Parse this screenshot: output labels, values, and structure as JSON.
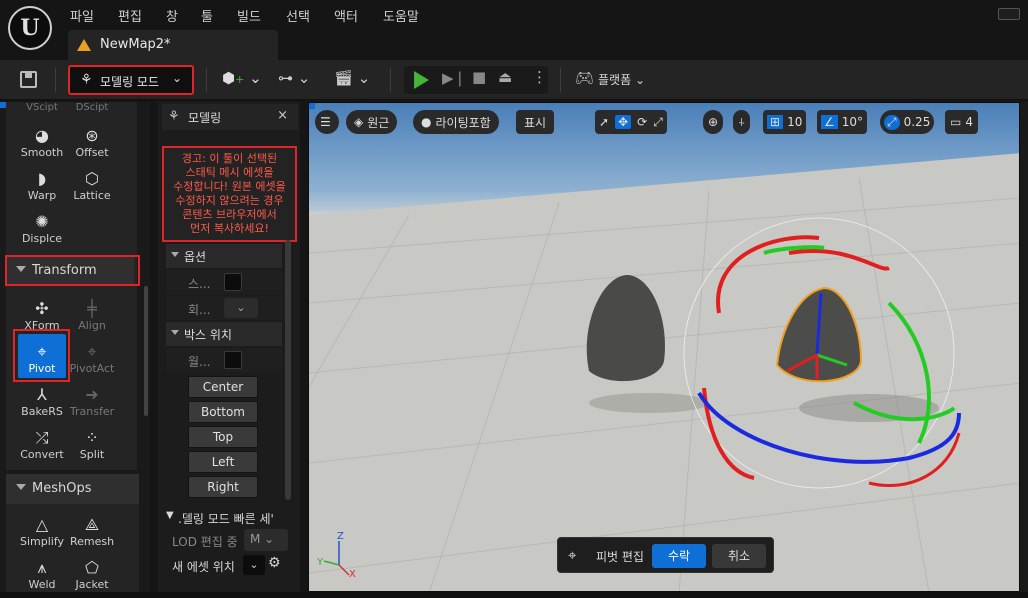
{
  "menu": {
    "logo": "U",
    "items": [
      "파일",
      "편집",
      "창",
      "툴",
      "빌드",
      "선택",
      "액터",
      "도움말"
    ]
  },
  "tab": {
    "label": "NewMap2*"
  },
  "toolbar": {
    "mode_label": "모델링 모드",
    "platform_label": "플랫폼"
  },
  "palette": {
    "top_labels": {
      "vscript": "VScipt",
      "dscript": "DScipt"
    },
    "tools_deform": [
      {
        "label": "Smooth",
        "icon": "smooth-icon"
      },
      {
        "label": "Offset",
        "icon": "offset-icon"
      },
      {
        "label": "Warp",
        "icon": "warp-icon"
      },
      {
        "label": "Lattice",
        "icon": "lattice-icon"
      },
      {
        "label": "Displce",
        "icon": "displace-icon"
      }
    ],
    "transform_section": "Transform",
    "tools_transform": [
      {
        "label": "XForm",
        "icon": "xform-icon"
      },
      {
        "label": "Align",
        "icon": "align-icon"
      },
      {
        "label": "Pivot",
        "icon": "pivot-icon"
      },
      {
        "label": "PivotAct",
        "icon": "pivot-actor-icon"
      },
      {
        "label": "BakeRS",
        "icon": "bake-rs-icon"
      },
      {
        "label": "Transfer",
        "icon": "transfer-icon"
      },
      {
        "label": "Convert",
        "icon": "convert-icon"
      },
      {
        "label": "Split",
        "icon": "split-icon"
      }
    ],
    "meshops_section": "MeshOps",
    "tools_meshops": [
      {
        "label": "Simplify",
        "icon": "simplify-icon"
      },
      {
        "label": "Remesh",
        "icon": "remesh-icon"
      },
      {
        "label": "Weld",
        "icon": "weld-icon"
      },
      {
        "label": "Jacket",
        "icon": "jacket-icon"
      }
    ]
  },
  "props": {
    "title": "모델링",
    "close": "×",
    "warning_lines": [
      "경고: 이 툴이 선택된",
      "스태틱 메시 에셋을",
      "수정합니다! 원본 에셋을",
      "수정하지 않으려는 경우",
      "콘텐츠 브라우저에서",
      "먼저 복사하세요!"
    ],
    "options_section": "옵션",
    "option_row1_label": "스...",
    "option_row2_label": "회...",
    "box_section": "박스 위치",
    "box_row_label": "월...",
    "buttons": [
      "Center",
      "Bottom",
      "Top",
      "Left",
      "Right"
    ],
    "quick_section": ".델링 모드 빠른 세'",
    "lod_label": "LOD 편집 중",
    "lod_value": "M",
    "asset_label": "새 에셋 위치"
  },
  "viewport": {
    "perspective": "원근",
    "lighting": "라이팅포함",
    "show": "표시",
    "grid_snap": "10",
    "rot_snap": "10°",
    "scale_snap": "0.25",
    "camera_speed": "4",
    "axis_labels": {
      "x": "X",
      "y": "Y",
      "z": "Z"
    },
    "pivot_edit_label": "피벗 편집",
    "accept_label": "수락",
    "cancel_label": "취소"
  },
  "colors": {
    "highlight_red": "#e0242a",
    "accent_blue": "#0e6fd6",
    "play_green": "#44b336",
    "warning_text": "#ff5a4a"
  }
}
